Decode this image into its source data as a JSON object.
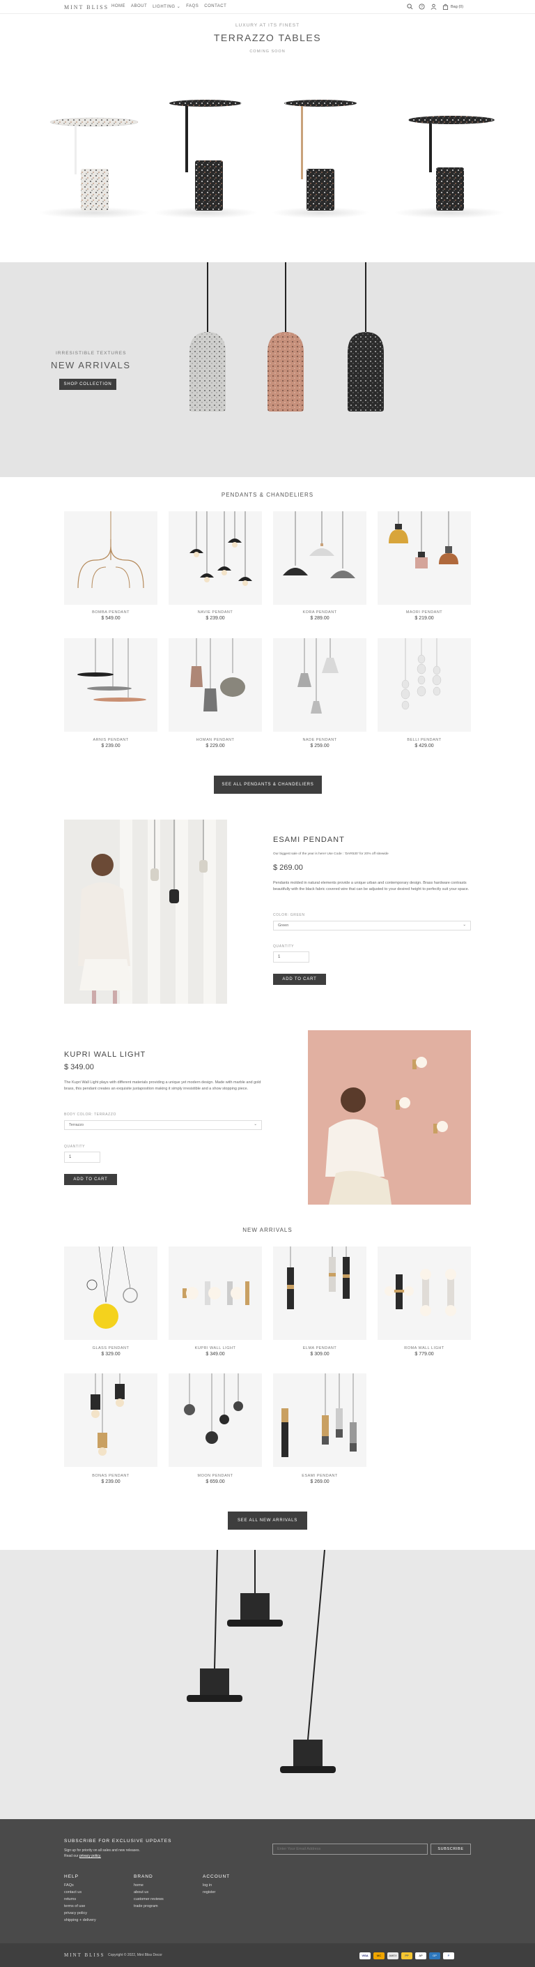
{
  "header": {
    "logo": "MINT BLISS",
    "nav": [
      "HOME",
      "ABOUT",
      "LIGHTING",
      "FAQS",
      "CONTACT"
    ],
    "nav_dropdown_arrow": "⌄",
    "bag": "Bag (0)"
  },
  "hero1": {
    "kicker": "LUXURY AT ITS FINEST",
    "title": "TERRAZZO TABLES",
    "subtitle": "COMING SOON"
  },
  "hero2": {
    "kicker": "IRRESISTIBLE TEXTURES",
    "title": "NEW ARRIVALS",
    "button": "SHOP COLLECTION"
  },
  "pendants": {
    "title": "PENDANTS & CHANDELIERS",
    "items": [
      {
        "name": "BOMBA PENDANT",
        "price": "$ 549.00"
      },
      {
        "name": "NAVIE PENDANT",
        "price": "$ 239.00"
      },
      {
        "name": "KORA PENDANT",
        "price": "$ 289.00"
      },
      {
        "name": "MAORI PENDANT",
        "price": "$ 219.00"
      },
      {
        "name": "ARNIS PENDANT",
        "price": "$ 239.00"
      },
      {
        "name": "HOMAN PENDANT",
        "price": "$ 229.00"
      },
      {
        "name": "NADE PENDANT",
        "price": "$ 259.00"
      },
      {
        "name": "BELLI PENDANT",
        "price": "$ 429.00"
      }
    ],
    "button": "SEE ALL PENDANTS & CHANDELIERS"
  },
  "esami": {
    "title": "ESAMI PENDANT",
    "promo": "Our biggest sale of the year is here! Use Code : 'DAR530' for 20% off sitewide",
    "price": "$ 269.00",
    "description": "Pendants molded in natural elements provide a unique urban and contemporary design. Brass hardware contrasts beautifully with the black fabric covered wire that can be adjusted to your desired height to perfectly suit your space.",
    "color_label": "COLOR: GREEN",
    "color_value": "Green",
    "qty_label": "QUANTITY",
    "qty_value": "1",
    "button": "ADD TO CART"
  },
  "kupri": {
    "title": "KUPRI WALL LIGHT",
    "price": "$ 349.00",
    "description": "The Kupri Wall Light plays with different materials providing a unique yet modern design. Made with marble and gold brass, this pendant creates an exquisite juxtaposition making it simply irresistible and a show stopping piece.",
    "color_label": "BODY COLOR: TERRAZZO",
    "color_value": "Terrazzo",
    "qty_label": "QUANTITY",
    "qty_value": "1",
    "button": "ADD TO CART"
  },
  "new_arrivals": {
    "title": "NEW ARRIVALS",
    "items": [
      {
        "name": "GLASS PENDANT",
        "price": "$ 329.00"
      },
      {
        "name": "KUPRI WALL LIGHT",
        "price": "$ 349.00"
      },
      {
        "name": "ELMA PENDANT",
        "price": "$ 309.00"
      },
      {
        "name": "ROMA WALL LIGHT",
        "price": "$ 779.00"
      },
      {
        "name": "BONAS PENDANT",
        "price": "$ 239.00"
      },
      {
        "name": "MOON PENDANT",
        "price": "$ 659.00"
      },
      {
        "name": "ESAMI PENDANT",
        "price": "$ 269.00"
      }
    ],
    "button": "SEE ALL NEW ARRIVALS"
  },
  "footer": {
    "subscribe_title": "SUBSCRIBE FOR EXCLUSIVE UPDATES",
    "subscribe_text": "Sign up for priority on all sales and new releases.",
    "privacy_prefix": "Read our",
    "privacy_link": "privacy policy.",
    "email_placeholder": "Enter Your Email Address",
    "subscribe_button": "SUBSCRIBE",
    "help_title": "HELP",
    "help_links": [
      "FAQs",
      "contact us",
      "returns",
      "terms of use",
      "privacy policy",
      "shipping + delivery"
    ],
    "brand_title": "BRAND",
    "brand_links": [
      "home",
      "about us",
      "customer reviews",
      "trade program"
    ],
    "account_title": "ACCOUNT",
    "account_links": [
      "log in",
      "register"
    ],
    "copyright": "Copyright © 2022, Mint Bliss Decor",
    "payments": [
      "VISA",
      "MC",
      "AMEX",
      "PP",
      "AP",
      "GP"
    ]
  }
}
